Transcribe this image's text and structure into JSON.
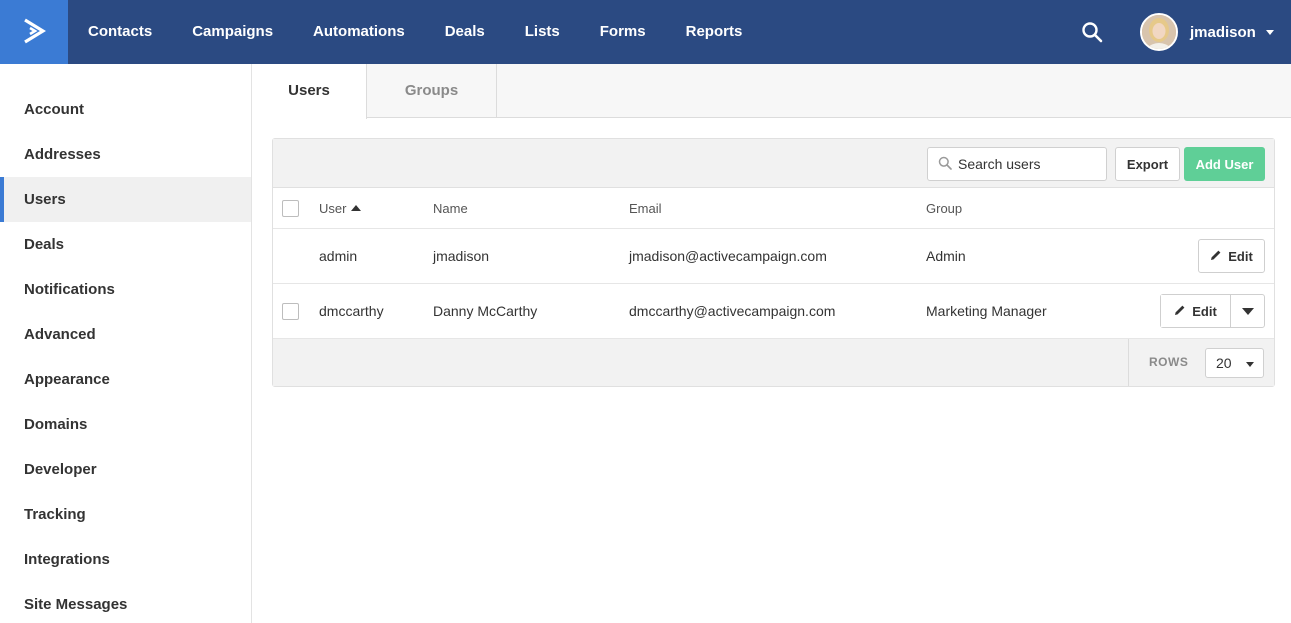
{
  "brand": {
    "logo_icon": "activecampaign-chevron-icon",
    "logo_color": "#3b7bd4",
    "topbar_color": "#2b4a82"
  },
  "nav": {
    "items": [
      {
        "label": "Contacts"
      },
      {
        "label": "Campaigns"
      },
      {
        "label": "Automations"
      },
      {
        "label": "Deals"
      },
      {
        "label": "Lists"
      },
      {
        "label": "Forms"
      },
      {
        "label": "Reports"
      }
    ],
    "search_icon": "search-icon"
  },
  "user_menu": {
    "username": "jmadison"
  },
  "sidebar": {
    "items": [
      {
        "label": "Account"
      },
      {
        "label": "Addresses"
      },
      {
        "label": "Users",
        "active": true
      },
      {
        "label": "Deals"
      },
      {
        "label": "Notifications"
      },
      {
        "label": "Advanced"
      },
      {
        "label": "Appearance"
      },
      {
        "label": "Domains"
      },
      {
        "label": "Developer"
      },
      {
        "label": "Tracking"
      },
      {
        "label": "Integrations"
      },
      {
        "label": "Site Messages"
      }
    ]
  },
  "tabs": [
    {
      "label": "Users",
      "active": true
    },
    {
      "label": "Groups",
      "active": false
    }
  ],
  "toolbar": {
    "search_placeholder": "Search users",
    "export_label": "Export",
    "add_user_label": "Add User",
    "add_user_color": "#5fcf97"
  },
  "table": {
    "columns": {
      "user": "User",
      "name": "Name",
      "email": "Email",
      "group": "Group"
    },
    "sort": {
      "column": "User",
      "direction": "ascending"
    },
    "rows": [
      {
        "user": "admin",
        "name": "jmadison",
        "email": "jmadison@activecampaign.com",
        "group": "Admin",
        "edit_label": "Edit"
      },
      {
        "user": "dmccarthy",
        "name": "Danny McCarthy",
        "email": "dmccarthy@activecampaign.com",
        "group": "Marketing Manager",
        "edit_label": "Edit"
      }
    ]
  },
  "footer": {
    "rows_label": "ROWS",
    "rows_value": "20"
  }
}
